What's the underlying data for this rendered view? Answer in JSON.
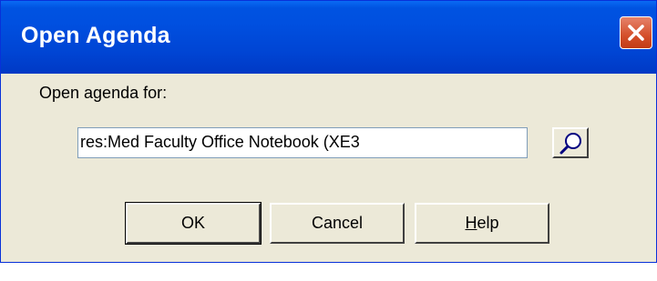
{
  "window": {
    "title": "Open Agenda"
  },
  "form": {
    "label": "Open agenda for:",
    "input_value": "res:Med Faculty Office Notebook (XE3"
  },
  "buttons": {
    "ok": "OK",
    "cancel": "Cancel",
    "help_first": "H",
    "help_rest": "elp"
  },
  "icons": {
    "close": "close-icon",
    "browse": "magnifier-icon"
  },
  "colors": {
    "titlebar": "#0050e0",
    "close": "#d44f2a",
    "dialog_bg": "#ece9d8"
  }
}
